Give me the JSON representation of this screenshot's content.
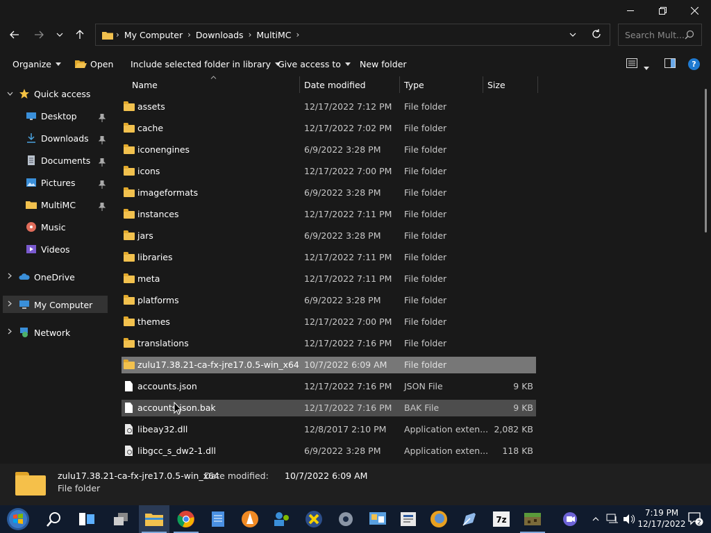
{
  "window": {
    "breadcrumb": [
      "My Computer",
      "Downloads",
      "MultiMC"
    ]
  },
  "search": {
    "placeholder": "Search Mult..."
  },
  "commandbar": {
    "organize": "Organize",
    "open": "Open",
    "include": "Include selected folder in library",
    "give_access": "Give access to",
    "new_folder": "New folder"
  },
  "navpane": {
    "quick_access": "Quick access",
    "items": [
      {
        "label": "Desktop",
        "icon": "desktop-icon"
      },
      {
        "label": "Downloads",
        "icon": "downloads-icon"
      },
      {
        "label": "Documents",
        "icon": "documents-icon"
      },
      {
        "label": "Pictures",
        "icon": "pictures-icon"
      },
      {
        "label": "MultiMC",
        "icon": "folder-icon"
      },
      {
        "label": "Music",
        "icon": "music-icon"
      },
      {
        "label": "Videos",
        "icon": "videos-icon"
      }
    ],
    "onedrive": "OneDrive",
    "my_computer": "My Computer",
    "network": "Network"
  },
  "columns": {
    "name": "Name",
    "date": "Date modified",
    "type": "Type",
    "size": "Size"
  },
  "files": [
    {
      "name": "assets",
      "date": "12/17/2022 7:12 PM",
      "type": "File folder",
      "size": "",
      "kind": "folder"
    },
    {
      "name": "cache",
      "date": "12/17/2022 7:02 PM",
      "type": "File folder",
      "size": "",
      "kind": "folder"
    },
    {
      "name": "iconengines",
      "date": "6/9/2022 3:28 PM",
      "type": "File folder",
      "size": "",
      "kind": "folder"
    },
    {
      "name": "icons",
      "date": "12/17/2022 7:00 PM",
      "type": "File folder",
      "size": "",
      "kind": "folder"
    },
    {
      "name": "imageformats",
      "date": "6/9/2022 3:28 PM",
      "type": "File folder",
      "size": "",
      "kind": "folder"
    },
    {
      "name": "instances",
      "date": "12/17/2022 7:11 PM",
      "type": "File folder",
      "size": "",
      "kind": "folder"
    },
    {
      "name": "jars",
      "date": "6/9/2022 3:28 PM",
      "type": "File folder",
      "size": "",
      "kind": "folder"
    },
    {
      "name": "libraries",
      "date": "12/17/2022 7:11 PM",
      "type": "File folder",
      "size": "",
      "kind": "folder"
    },
    {
      "name": "meta",
      "date": "12/17/2022 7:11 PM",
      "type": "File folder",
      "size": "",
      "kind": "folder"
    },
    {
      "name": "platforms",
      "date": "6/9/2022 3:28 PM",
      "type": "File folder",
      "size": "",
      "kind": "folder"
    },
    {
      "name": "themes",
      "date": "12/17/2022 7:00 PM",
      "type": "File folder",
      "size": "",
      "kind": "folder"
    },
    {
      "name": "translations",
      "date": "12/17/2022 7:16 PM",
      "type": "File folder",
      "size": "",
      "kind": "folder"
    },
    {
      "name": "zulu17.38.21-ca-fx-jre17.0.5-win_x64",
      "date": "10/7/2022 6:09 AM",
      "type": "File folder",
      "size": "",
      "kind": "folder",
      "state": "selected"
    },
    {
      "name": "accounts.json",
      "date": "12/17/2022 7:16 PM",
      "type": "JSON File",
      "size": "9 KB",
      "kind": "doc"
    },
    {
      "name": "accounts.json.bak",
      "date": "12/17/2022 7:16 PM",
      "type": "BAK File",
      "size": "9 KB",
      "kind": "doc",
      "state": "hover"
    },
    {
      "name": "libeay32.dll",
      "date": "12/8/2017 2:10 PM",
      "type": "Application exten...",
      "size": "2,082 KB",
      "kind": "dll"
    },
    {
      "name": "libgcc_s_dw2-1.dll",
      "date": "6/9/2022 3:28 PM",
      "type": "Application exten...",
      "size": "118 KB",
      "kind": "dll"
    }
  ],
  "details": {
    "name": "zulu17.38.21-ca-fx-jre17.0.5-win_x64",
    "modified_label": "Date modified:",
    "modified_value": "10/7/2022 6:09 AM",
    "type": "File folder"
  },
  "taskbar": {
    "time": "7:19 PM",
    "date": "12/17/2022",
    "apps": [
      "start-orb",
      "search",
      "task-view",
      "desktop-switch",
      "file-explorer",
      "chrome",
      "notepad",
      "vlc",
      "share",
      "xmind",
      "settings",
      "control-panel",
      "reader",
      "firefox",
      "edit",
      "7zip",
      "minecraft",
      "meet"
    ],
    "notification_count": "2"
  },
  "colors": {
    "background": "#191919",
    "selected_row": "#777777",
    "hover_row": "#4d4d4d",
    "folder": "#f2c14e",
    "taskbar": "#101b2d",
    "accent": "#1f7ad1"
  }
}
